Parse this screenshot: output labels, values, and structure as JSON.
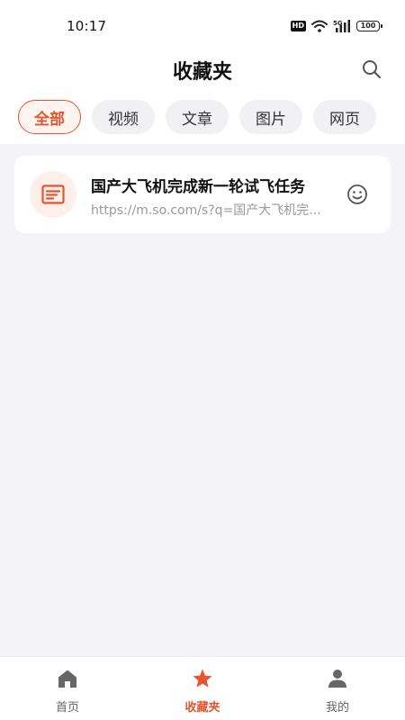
{
  "status_bar": {
    "time": "10:17",
    "network": "5G",
    "battery": "100"
  },
  "header": {
    "title": "收藏夹",
    "search_icon": "search-icon"
  },
  "tabs": [
    {
      "label": "全部",
      "active": true
    },
    {
      "label": "视频",
      "active": false
    },
    {
      "label": "文章",
      "active": false
    },
    {
      "label": "图片",
      "active": false
    },
    {
      "label": "网页",
      "active": false
    }
  ],
  "favorites": [
    {
      "title": "国产大飞机完成新一轮试飞任务",
      "url": "https://m.so.com/s?q=国产大飞机完...",
      "thumb_icon": "article-icon",
      "action_icon": "smiley-icon"
    }
  ],
  "bottom_nav": [
    {
      "label": "首页",
      "icon": "home-icon",
      "active": false
    },
    {
      "label": "收藏夹",
      "icon": "star-icon",
      "active": true
    },
    {
      "label": "我的",
      "icon": "user-icon",
      "active": false
    }
  ],
  "colors": {
    "accent": "#e8542f",
    "page_background": "#f4f4f6",
    "inactive_icon": "#666666"
  }
}
